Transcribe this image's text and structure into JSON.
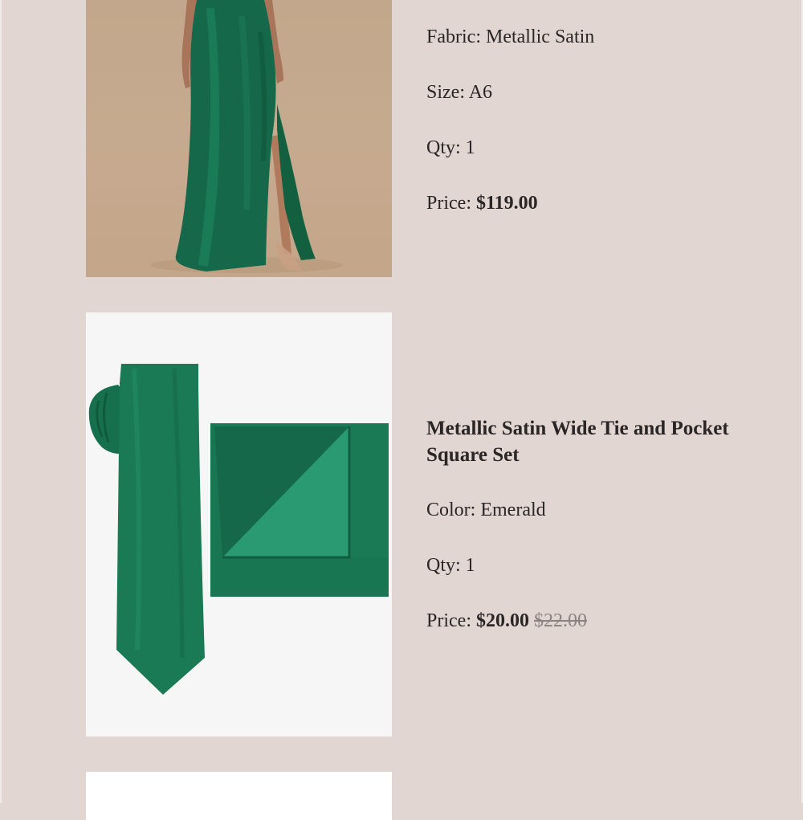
{
  "item1": {
    "fabric_label": "Fabric:",
    "fabric_value": "Metallic Satin",
    "size_label": "Size:",
    "size_value": "A6",
    "qty_label": "Qty:",
    "qty_value": "1",
    "price_label": "Price:",
    "price_value": "$119.00"
  },
  "item2": {
    "title": "Metallic Satin Wide Tie and Pocket Square Set",
    "color_label": "Color:",
    "color_value": "Emerald",
    "qty_label": "Qty:",
    "qty_value": "1",
    "price_label": "Price:",
    "price_value": "$20.00",
    "original_price": "$22.00"
  },
  "colors": {
    "background": "#e2d6d2",
    "emerald": "#1a7a55",
    "text": "#2a2626"
  }
}
